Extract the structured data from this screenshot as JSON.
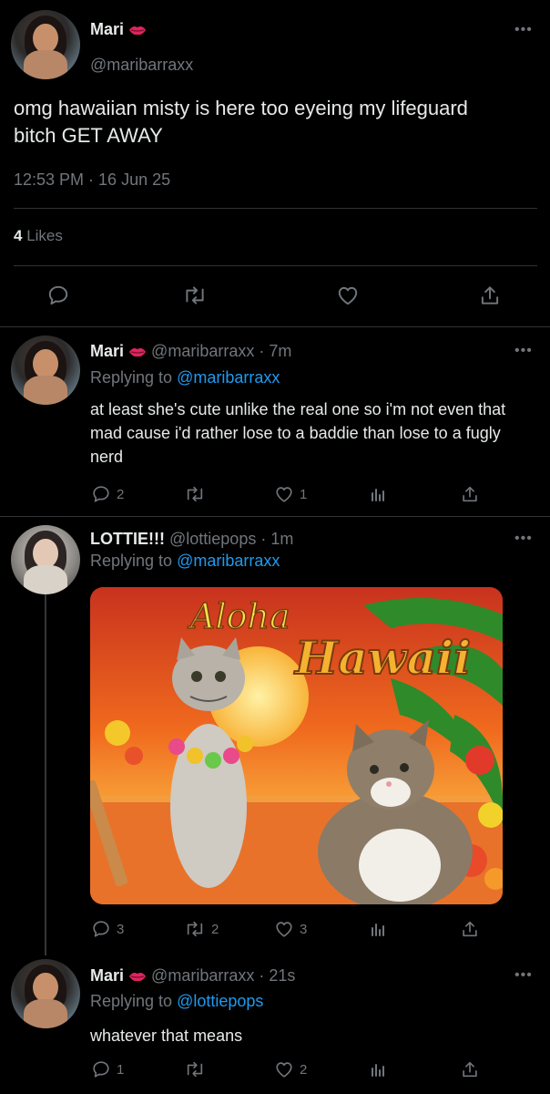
{
  "main_tweet": {
    "display_name": "Mari",
    "handle": "@maribarraxx",
    "text": "omg hawaiian misty is here too eyeing my lifeguard bitch GET AWAY",
    "timestamp": "12:53 PM · 16 Jun 25",
    "likes_count": "4",
    "likes_label": "Likes"
  },
  "replies": [
    {
      "display_name": "Mari",
      "handle": "@maribarraxx",
      "time": "· 7m",
      "replying_label": "Replying to",
      "replying_to": "@maribarraxx",
      "text": "at least she's cute unlike the real one so i'm not even that mad cause i'd rather lose to a baddie than lose to a fugly nerd",
      "reply_count": "2",
      "retweet_count": "",
      "like_count": "1"
    },
    {
      "display_name": "LOTTIE!!!",
      "handle": "@lottiepops",
      "time": "· 1m",
      "replying_label": "Replying to",
      "replying_to": "@maribarraxx",
      "image": {
        "title_top": "Aloha",
        "title_bottom": "Hawaii"
      },
      "reply_count": "3",
      "retweet_count": "2",
      "like_count": "3"
    },
    {
      "display_name": "Mari",
      "handle": "@maribarraxx",
      "time": "· 21s",
      "replying_label": "Replying to",
      "replying_to": "@lottiepops",
      "text": "whatever that means",
      "reply_count": "1",
      "retweet_count": "",
      "like_count": "2"
    }
  ],
  "colors": {
    "background": "#000000",
    "text": "#e7e9ea",
    "muted": "#71767b",
    "link": "#1d9bf0",
    "divider": "#2f3336"
  },
  "icons": [
    "more-icon",
    "reply-icon",
    "retweet-icon",
    "like-icon",
    "share-icon",
    "analytics-icon",
    "lips-emoji-icon"
  ]
}
